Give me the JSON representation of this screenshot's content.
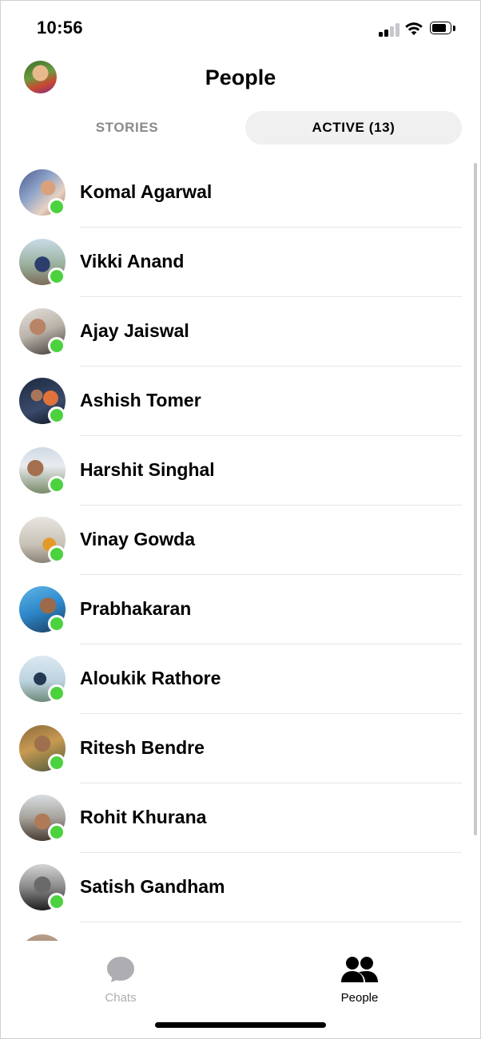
{
  "status_bar": {
    "time": "10:56"
  },
  "header": {
    "title": "People"
  },
  "tabs": [
    {
      "label": "STORIES",
      "selected": false
    },
    {
      "label": "ACTIVE (13)",
      "selected": true
    }
  ],
  "people": [
    {
      "name": "Komal Agarwal",
      "active": true
    },
    {
      "name": "Vikki Anand",
      "active": true
    },
    {
      "name": "Ajay Jaiswal",
      "active": true
    },
    {
      "name": "Ashish Tomer",
      "active": true
    },
    {
      "name": "Harshit Singhal",
      "active": true
    },
    {
      "name": "Vinay Gowda",
      "active": true
    },
    {
      "name": "Prabhakaran",
      "active": true
    },
    {
      "name": "Aloukik Rathore",
      "active": true
    },
    {
      "name": "Ritesh Bendre",
      "active": true
    },
    {
      "name": "Rohit Khurana",
      "active": true
    },
    {
      "name": "Satish Gandham",
      "active": true
    }
  ],
  "tab_bar": {
    "items": [
      {
        "label": "Chats",
        "icon": "chat-bubble-icon",
        "selected": false
      },
      {
        "label": "People",
        "icon": "people-icon",
        "selected": true
      }
    ]
  },
  "colors": {
    "presence": "#4bd23e",
    "inactive_tab": "#8a8a8e",
    "active_tab_bg": "#f0f0f0"
  }
}
